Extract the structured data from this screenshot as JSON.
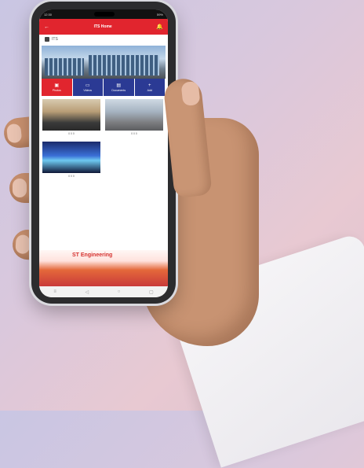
{
  "status": {
    "time": "12:30",
    "battery": "59%"
  },
  "appbar": {
    "back_icon": "arrow-left-icon",
    "title": "ITS Home",
    "bell_icon": "bell-icon"
  },
  "crumb": {
    "label": "ITS"
  },
  "tiles": [
    {
      "label": "Photos",
      "icon": "photo-icon"
    },
    {
      "label": "Videos",
      "icon": "video-icon"
    },
    {
      "label": "Documents",
      "icon": "document-icon"
    },
    {
      "label": "Add",
      "icon": "plus-icon"
    }
  ],
  "cards": [
    {
      "meta": "0  0  0"
    },
    {
      "meta": "0  0  0"
    },
    {
      "meta": "0  0  0"
    }
  ],
  "banner": {
    "brand": "ST Engineering"
  },
  "colors": {
    "accent": "#e1252e",
    "tile": "#2b3a94"
  }
}
